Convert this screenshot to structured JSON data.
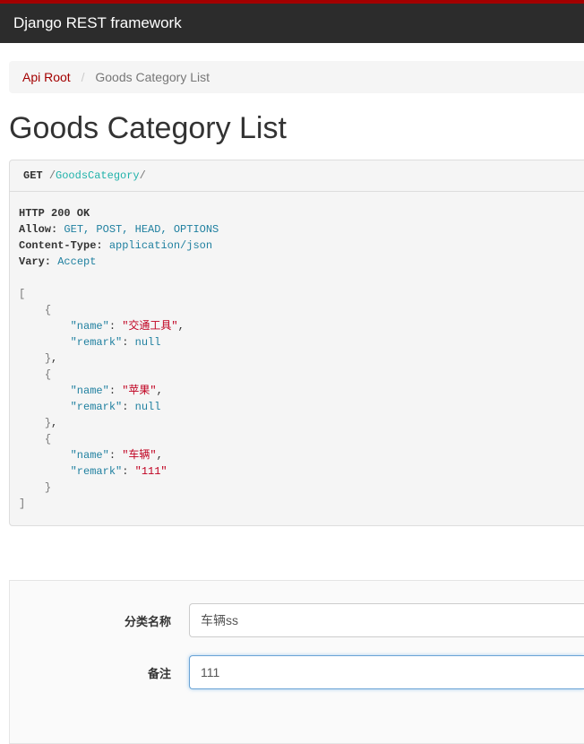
{
  "navbar": {
    "brand": "Django REST framework"
  },
  "breadcrumb": {
    "root_label": "Api Root",
    "current": "Goods Category List"
  },
  "page": {
    "title": "Goods Category List"
  },
  "request": {
    "method": "GET",
    "path_segment": "GoodsCategory"
  },
  "response": {
    "status_line": "HTTP 200 OK",
    "headers": {
      "allow_label": "Allow:",
      "allow_value": "GET, POST, HEAD, OPTIONS",
      "content_type_label": "Content-Type:",
      "content_type_value": "application/json",
      "vary_label": "Vary:",
      "vary_value": "Accept"
    },
    "body": [
      {
        "name": "交通工具",
        "remark": null
      },
      {
        "name": "苹果",
        "remark": null
      },
      {
        "name": "车辆",
        "remark": "111"
      }
    ]
  },
  "form": {
    "name_label": "分类名称",
    "name_value": "车辆ss",
    "remark_label": "备注",
    "remark_value": "111"
  }
}
